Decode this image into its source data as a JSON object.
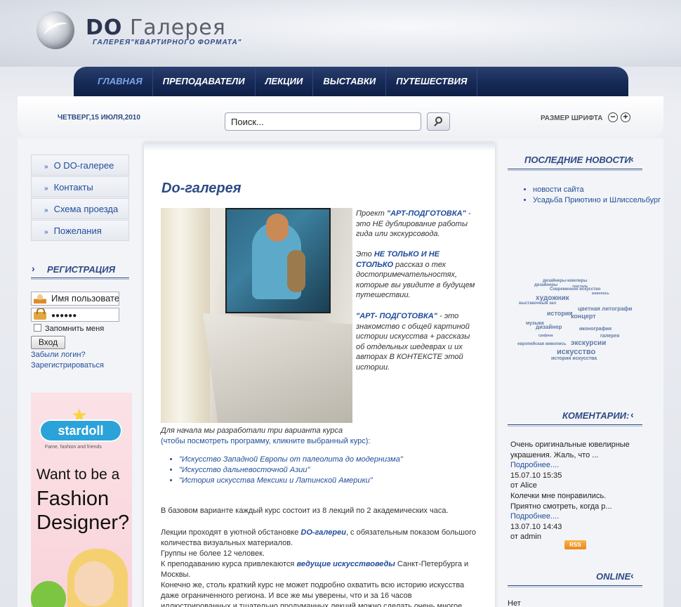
{
  "header": {
    "logo_do": "DO",
    "logo_rest": "Галерея",
    "subtitle": "ГАЛЕРЕЯ\"КВАРТИРНОГО ФОРМАТА\""
  },
  "nav": [
    {
      "label": "ГЛАВНАЯ",
      "active": true
    },
    {
      "label": "ПРЕПОДАВАТЕЛИ",
      "active": false
    },
    {
      "label": "ЛЕКЦИИ",
      "active": false
    },
    {
      "label": "ВЫСТАВКИ",
      "active": false
    },
    {
      "label": "ПУТЕШЕСТВИЯ",
      "active": false
    }
  ],
  "topbar": {
    "date": "ЧЕТВЕРГ,15 ИЮЛЯ,2010",
    "search_value": "Поиск...",
    "font_size_label": "РАЗМЕР ШРИФТА",
    "font_minus": "−",
    "font_plus": "+"
  },
  "left_menu": [
    "О DO-галерее",
    "Контакты",
    "Схема проезда",
    "Пожелания"
  ],
  "registration": {
    "title": "РЕГИСТРАЦИЯ",
    "username": "Имя пользователя",
    "password_mask": "●●●●●●",
    "remember": "Запомнить меня",
    "login_button": "Вход",
    "forgot": "Забыли логин?",
    "register": "Зарегистрироваться"
  },
  "ad": {
    "brand": "stardoll",
    "tagline": "Fame, fashion and friends",
    "line1": "Want to be a",
    "line2": "Fashion",
    "line3": "Designer?"
  },
  "main": {
    "title": "Do-галерея",
    "intro1_pre": "Проект ",
    "intro1_bold": "\"АРТ-ПОДГОТОВКА\"",
    "intro1_post": " - это НЕ дублирование работы гида или экскурсовода.",
    "intro2_pre": "Это ",
    "intro2_bold": "НЕ ТОЛЬКО И НЕ СТОЛЬКО",
    "intro2_post": " рассказ о тех достопримечательностях, которые вы увидите в будущем путешествии.",
    "intro3_bold": "\"АРТ- ПОДГОТОВКА\"",
    "intro3_post": " - это знакомство с общей картиной истории искусства + рассказы об отдельных шедеврах и их авторах В КОНТЕКСТЕ этой истории.",
    "variants_line": "Для начала мы разработали три варианта курса",
    "variants_link": "(чтобы посмотреть программу, кликните выбранный курс):",
    "courses": [
      "\"Искусство Западной Европы от палеолита до модернизма\"",
      "\"Искусство дальневосточной Азии\"",
      "\"История искусства Мексики и Латинской Америки\""
    ],
    "base_variant": "В базовом варианте каждый курс состоит из 8 лекций по 2 академических часа.",
    "p2_pre": "Лекции проходят в уютной обстановке ",
    "p2_bold": "DO-галереи",
    "p2_post": ", с обязательным показом большого количества визуальных материалов.",
    "p3": "Группы не более 12 человек.",
    "p4_pre": "К преподаванию курса привлекаются ",
    "p4_bold": "ведущие искусствоведы",
    "p4_post": " Санкт-Петербурга и Москвы.",
    "p5": "Конечно же, столь краткий курс не может подробно охватить всю историю искусства даже ограниченного региона. И все же мы уверены, что и за 16 часов иллюстрированных и тщательно продуманных лекций можно сделать очень многое."
  },
  "right": {
    "news_title": "ПОСЛЕДНИЕ НОВОСТИ",
    "news": [
      "новости сайта",
      "Усадьба Приютино и Шлиссельбург"
    ],
    "tags": [
      {
        "t": "дизайнеры-ювелиры",
        "s": 6
      },
      {
        "t": "дизайнеры",
        "s": 6
      },
      {
        "t": "текстиль",
        "s": 5
      },
      {
        "t": "Современное искусство",
        "s": 6
      },
      {
        "t": "живопись",
        "s": 5
      },
      {
        "t": "художник",
        "s": 10
      },
      {
        "t": "выставочный зал",
        "s": 6
      },
      {
        "t": "цветная литографи",
        "s": 8
      },
      {
        "t": "история",
        "s": 9
      },
      {
        "t": "концерт",
        "s": 9
      },
      {
        "t": "музыка",
        "s": 7
      },
      {
        "t": "дизайнер",
        "s": 8
      },
      {
        "t": "иконография",
        "s": 7
      },
      {
        "t": "графика",
        "s": 5
      },
      {
        "t": "галерея",
        "s": 7
      },
      {
        "t": "экскурсии",
        "s": 10
      },
      {
        "t": "европейская живопись",
        "s": 6
      },
      {
        "t": "искусство",
        "s": 11
      },
      {
        "t": "история искусства",
        "s": 7
      }
    ],
    "comments_title": "КОМЕНТАРИИ:",
    "comment1_text": "Очень оригинальные ювелирные украшения. Жаль, что ...",
    "comment1_more": "Подробнее....",
    "comment1_date": "15.07.10 15:35",
    "comment1_author": "от Alice",
    "comment2_text": "Колечки мне понравились. Приятно смотреть, когда р...",
    "comment2_more": "Подробнее....",
    "comment2_date": "13.07.10 14:43",
    "comment2_author": "от admin",
    "rss": "RSS",
    "online_title": "ONLINE",
    "online_text": "Нет"
  },
  "colors": {
    "accent": "#2e4a86",
    "link": "#1f4d9a",
    "nav_bg": "#162a57"
  }
}
